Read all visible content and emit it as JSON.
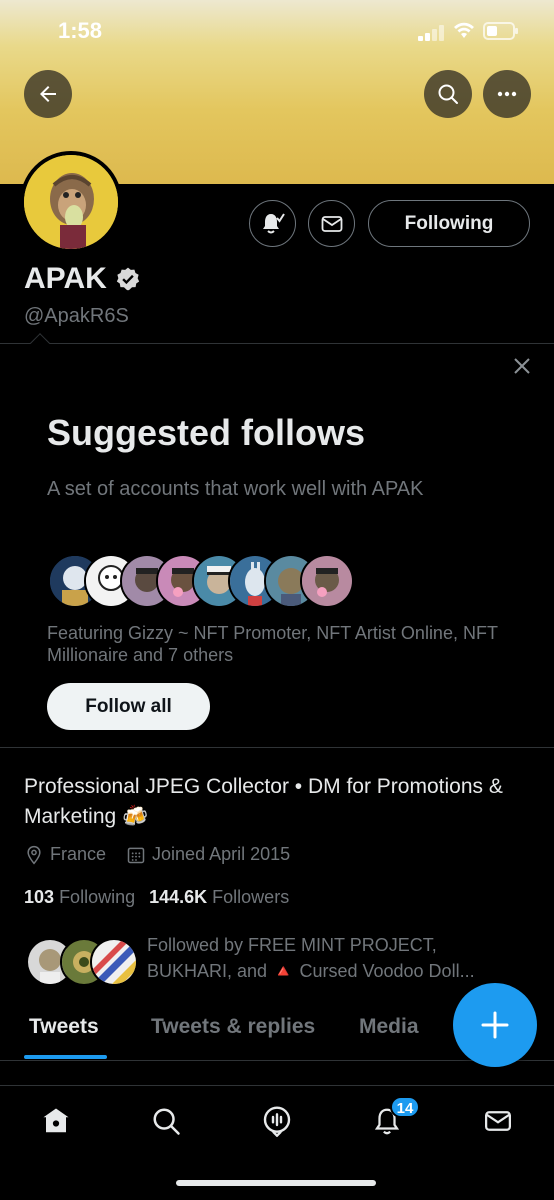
{
  "status_bar": {
    "time": "1:58"
  },
  "profile": {
    "name": "APAK",
    "handle": "@ApakR6S",
    "following_button": "Following",
    "bio": "Professional JPEG Collector • DM for Promotions & Marketing 🍻",
    "location": "France",
    "joined": "Joined April 2015",
    "following_count": "103",
    "following_label": "Following",
    "followers_count": "144.6K",
    "followers_label": "Followers",
    "followed_by": "Followed by FREE MINT PROJECT, BUKHARI, and 🔺 Cursed Voodoo Doll..."
  },
  "suggested": {
    "title": "Suggested follows",
    "subtitle": "A set of accounts that work well with APAK",
    "featuring": "Featuring Gizzy ~ NFT Promoter, NFT Artist Online, NFT Millionaire and 7 others",
    "follow_all": "Follow all"
  },
  "tabs": [
    {
      "label": "Tweets"
    },
    {
      "label": "Tweets & replies"
    },
    {
      "label": "Media"
    }
  ],
  "nav": {
    "notifications_badge": "14"
  },
  "colors": {
    "accent": "#1d9bf0",
    "banner": "#e3c65e"
  }
}
